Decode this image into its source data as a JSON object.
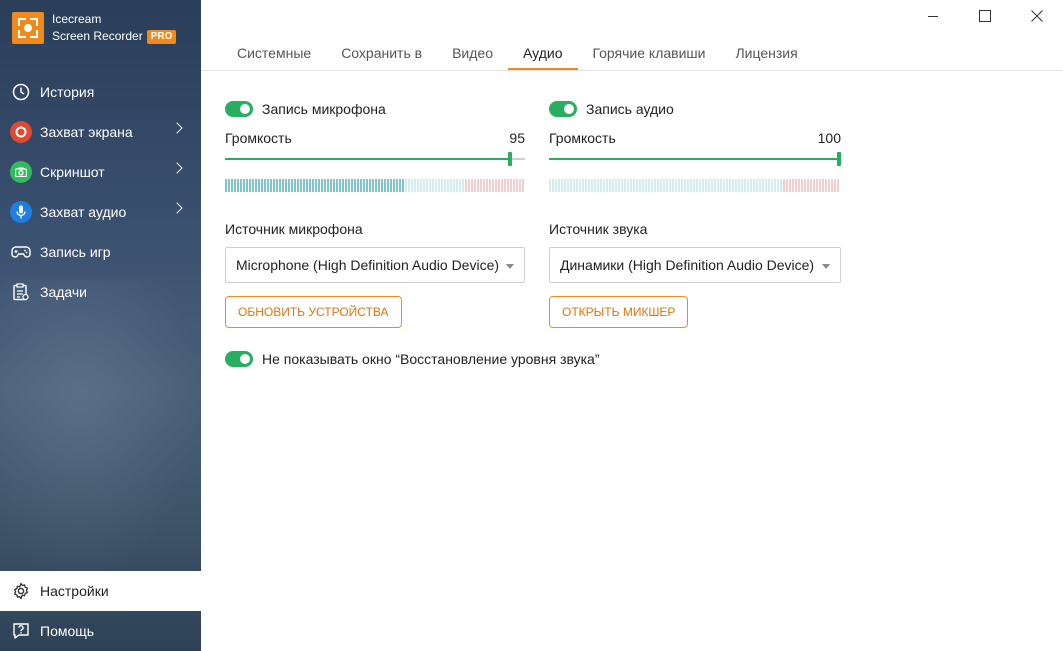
{
  "app": {
    "name_line1": "Icecream",
    "name_line2": "Screen Recorder",
    "badge": "PRO",
    "accent_color": "#f08a1c"
  },
  "sidebar": {
    "items": [
      {
        "label": "История",
        "icon": "clock-icon"
      },
      {
        "label": "Захват экрана",
        "icon": "record-icon",
        "color": "#e04a32"
      },
      {
        "label": "Скриншот",
        "icon": "camera-icon",
        "color": "#2ebd5a"
      },
      {
        "label": "Захват аудио",
        "icon": "microphone-icon",
        "color": "#1f7fe0"
      },
      {
        "label": "Запись игр",
        "icon": "gamepad-icon"
      },
      {
        "label": "Задачи",
        "icon": "tasks-icon"
      }
    ],
    "bottom": [
      {
        "label": "Настройки",
        "icon": "gear-icon"
      },
      {
        "label": "Помощь",
        "icon": "help-icon"
      }
    ]
  },
  "tabs": [
    "Системные",
    "Сохранить в",
    "Видео",
    "Аудио",
    "Горячие клавиши",
    "Лицензия"
  ],
  "active_tab": "Аудио",
  "microphone": {
    "toggle_label": "Запись микрофона",
    "enabled": true,
    "volume_label": "Громкость",
    "volume": "95",
    "volume_fraction": 0.95,
    "level_fraction": 0.6,
    "source_label": "Источник микрофона",
    "source_value": "Microphone (High Definition Audio Device)",
    "button": "ОБНОВИТЬ УСТРОЙСТВА"
  },
  "audio": {
    "toggle_label": "Запись аудио",
    "enabled": true,
    "volume_label": "Громкость",
    "volume": "100",
    "volume_fraction": 1.0,
    "level_fraction": 0.0,
    "source_label": "Источник звука",
    "source_value": "Динамики (High Definition Audio Device)",
    "button": "ОТКРЫТЬ МИКШЕР"
  },
  "restore_toggle": {
    "label": "Не показывать окно “Восстановление уровня звука”",
    "enabled": true
  }
}
